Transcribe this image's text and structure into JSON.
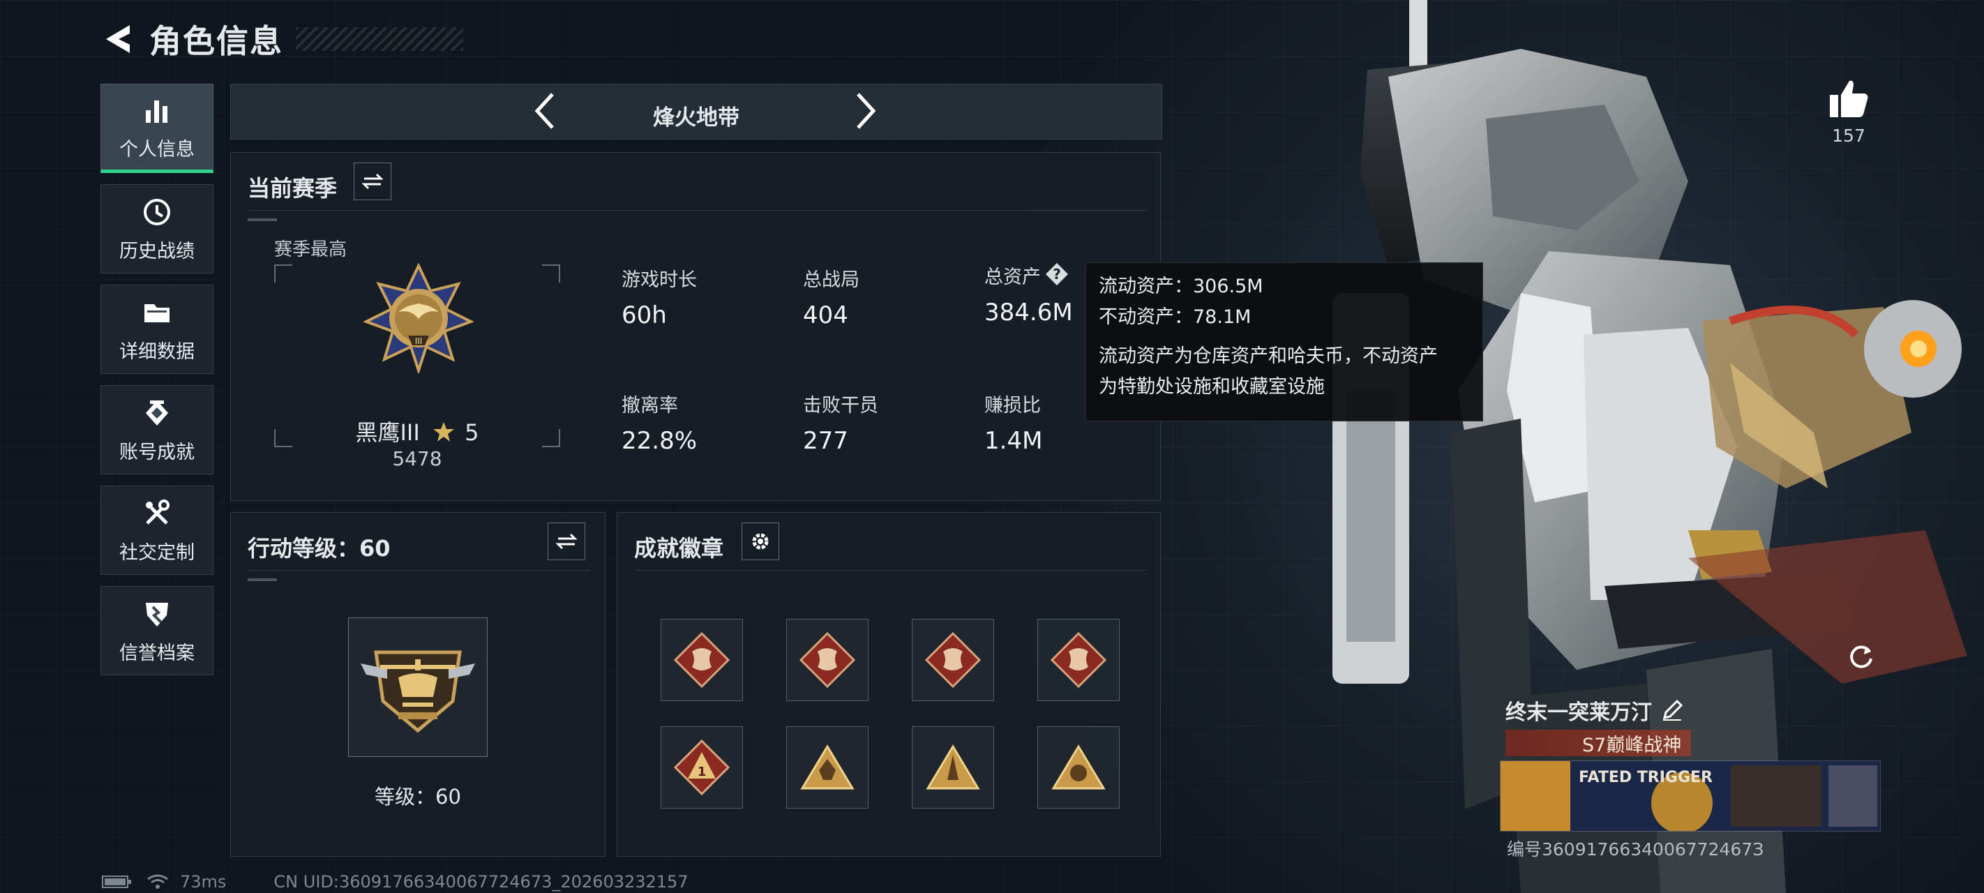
{
  "header": {
    "title": "角色信息"
  },
  "sidebar": {
    "items": [
      {
        "label": "个人信息",
        "icon": "bar-chart-icon",
        "active": true
      },
      {
        "label": "历史战绩",
        "icon": "clock-icon"
      },
      {
        "label": "详细数据",
        "icon": "folder-icon"
      },
      {
        "label": "账号成就",
        "icon": "achievement-icon"
      },
      {
        "label": "社交定制",
        "icon": "tools-icon"
      },
      {
        "label": "信誉档案",
        "icon": "shield-icon"
      }
    ]
  },
  "mode_selector": {
    "current": "烽火地带"
  },
  "season_panel": {
    "title": "当前赛季",
    "subtitle": "赛季最高",
    "rank": {
      "name": "黑鹰III",
      "stars": "5",
      "score": "5478",
      "emblem": "black-eagle-medal-icon"
    },
    "stats": [
      {
        "label": "游戏时长",
        "value": "60h"
      },
      {
        "label": "总战局",
        "value": "404"
      },
      {
        "label": "总资产",
        "value": "384.6M",
        "has_help": true
      },
      {
        "label": "撤离率",
        "value": "22.8%"
      },
      {
        "label": "击败干员",
        "value": "277"
      },
      {
        "label": "赚损比",
        "value": "1.4M"
      }
    ]
  },
  "asset_tooltip": {
    "line1": "流动资产：306.5M",
    "line2": "不动资产：78.1M",
    "desc1": "流动资产为仓库资产和哈夫币，不动资产",
    "desc2": "为特勤处设施和收藏室设施"
  },
  "action_level_panel": {
    "title": "行动等级：60",
    "level_text": "等级：60",
    "emblem": "helicopter-emblem-icon"
  },
  "achievement_panel": {
    "title": "成就徽章",
    "badges": [
      "dragon-badge-icon",
      "dragon-badge-icon",
      "dragon-badge-icon",
      "dragon-badge-icon",
      "triangle-badge-icon",
      "triangle-badge-icon",
      "triangle-badge-icon",
      "triangle-badge-icon"
    ]
  },
  "likes": {
    "count": "157"
  },
  "player": {
    "name": "终末一突莱万汀",
    "title": "S7巅峰战神",
    "namecard_text": "FATED TRIGGER",
    "id": "编号3609176634006772467З"
  },
  "status_bar": {
    "ping": "73ms",
    "uid": "CN UID:36091766340067724673_202603232157"
  },
  "colors": {
    "accent": "#2fd48a",
    "badge_red": "#8a2a22",
    "gold": "#c9a15a"
  }
}
